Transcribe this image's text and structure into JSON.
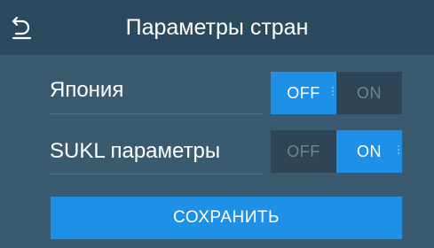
{
  "header": {
    "title": "Параметры стран",
    "back_icon": "back-arrow-icon"
  },
  "settings": [
    {
      "label": "Япония",
      "off_label": "OFF",
      "on_label": "ON",
      "state": "OFF"
    },
    {
      "label": "SUKL параметры",
      "off_label": "OFF",
      "on_label": "ON",
      "state": "ON"
    }
  ],
  "save_button": {
    "label": "СОХРАНИТЬ"
  },
  "colors": {
    "background": "#3a5a70",
    "header": "#2b4a5f",
    "accent": "#1e90e8",
    "toggle_track": "#2e4557",
    "inactive_text": "#6c8596"
  }
}
